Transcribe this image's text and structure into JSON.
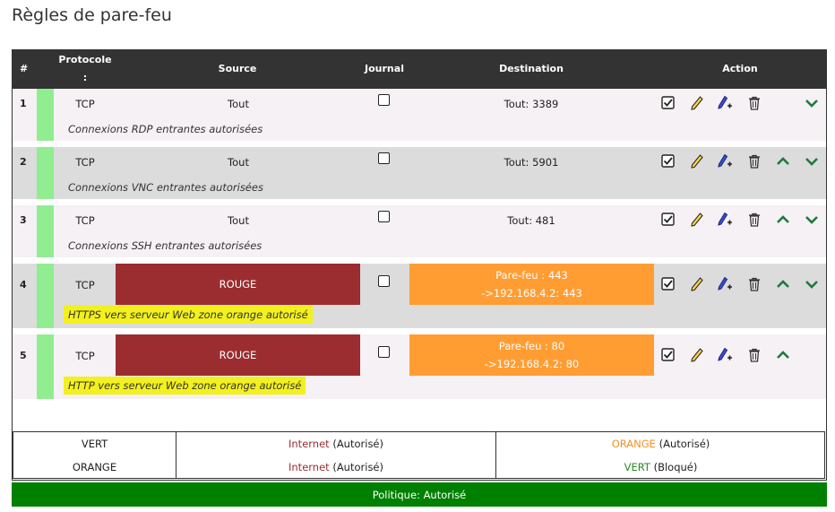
{
  "page": {
    "title": "Règles de pare-feu"
  },
  "table_header": {
    "num": "#",
    "protocol": "Protocole",
    "protocol_suffix": ":",
    "source": "Source",
    "journal": "Journal",
    "destination": "Destination",
    "action": "Action"
  },
  "rules": [
    {
      "num": "1",
      "protocol": "TCP",
      "source": "Tout",
      "destination": "Tout: 3389",
      "remark": "Connexions RDP entrantes autorisées"
    },
    {
      "num": "2",
      "protocol": "TCP",
      "source": "Tout",
      "destination": "Tout: 5901",
      "remark": "Connexions VNC entrantes autorisées"
    },
    {
      "num": "3",
      "protocol": "TCP",
      "source": "Tout",
      "destination": "Tout: 481",
      "remark": "Connexions SSH entrantes autorisées"
    },
    {
      "num": "4",
      "protocol": "TCP",
      "source": "ROUGE",
      "destination_line1": "Pare-feu : 443",
      "destination_line2": "->192.168.4.2: 443",
      "remark": "HTTPS vers serveur Web zone orange autorisé"
    },
    {
      "num": "5",
      "protocol": "TCP",
      "source": "ROUGE",
      "destination_line1": "Pare-feu : 80",
      "destination_line2": "->192.168.4.2: 80",
      "remark": "HTTP vers serveur Web zone orange autorisé"
    }
  ],
  "legend": {
    "row1": {
      "zone": "VERT",
      "target": "Internet",
      "target_status": "(Autorisé)",
      "other": "ORANGE",
      "other_status": "(Autorisé)"
    },
    "row2": {
      "zone": "ORANGE",
      "target": "Internet",
      "target_status": "(Autorisé)",
      "other": "VERT",
      "other_status": "(Bloqué)"
    }
  },
  "footer": {
    "policy": "Politique: Autorisé"
  },
  "colors": {
    "header_bg": "#333333",
    "enabled_bar": "#90ee90",
    "red_zone": "#9b2d30",
    "orange_zone": "#ff9d33",
    "highlight": "#f2f01e",
    "policy_green": "#008000"
  },
  "icons": [
    "checkbox-checked-icon",
    "pencil-icon",
    "pen-add-icon",
    "trash-icon",
    "arrow-up-icon",
    "arrow-down-icon"
  ]
}
